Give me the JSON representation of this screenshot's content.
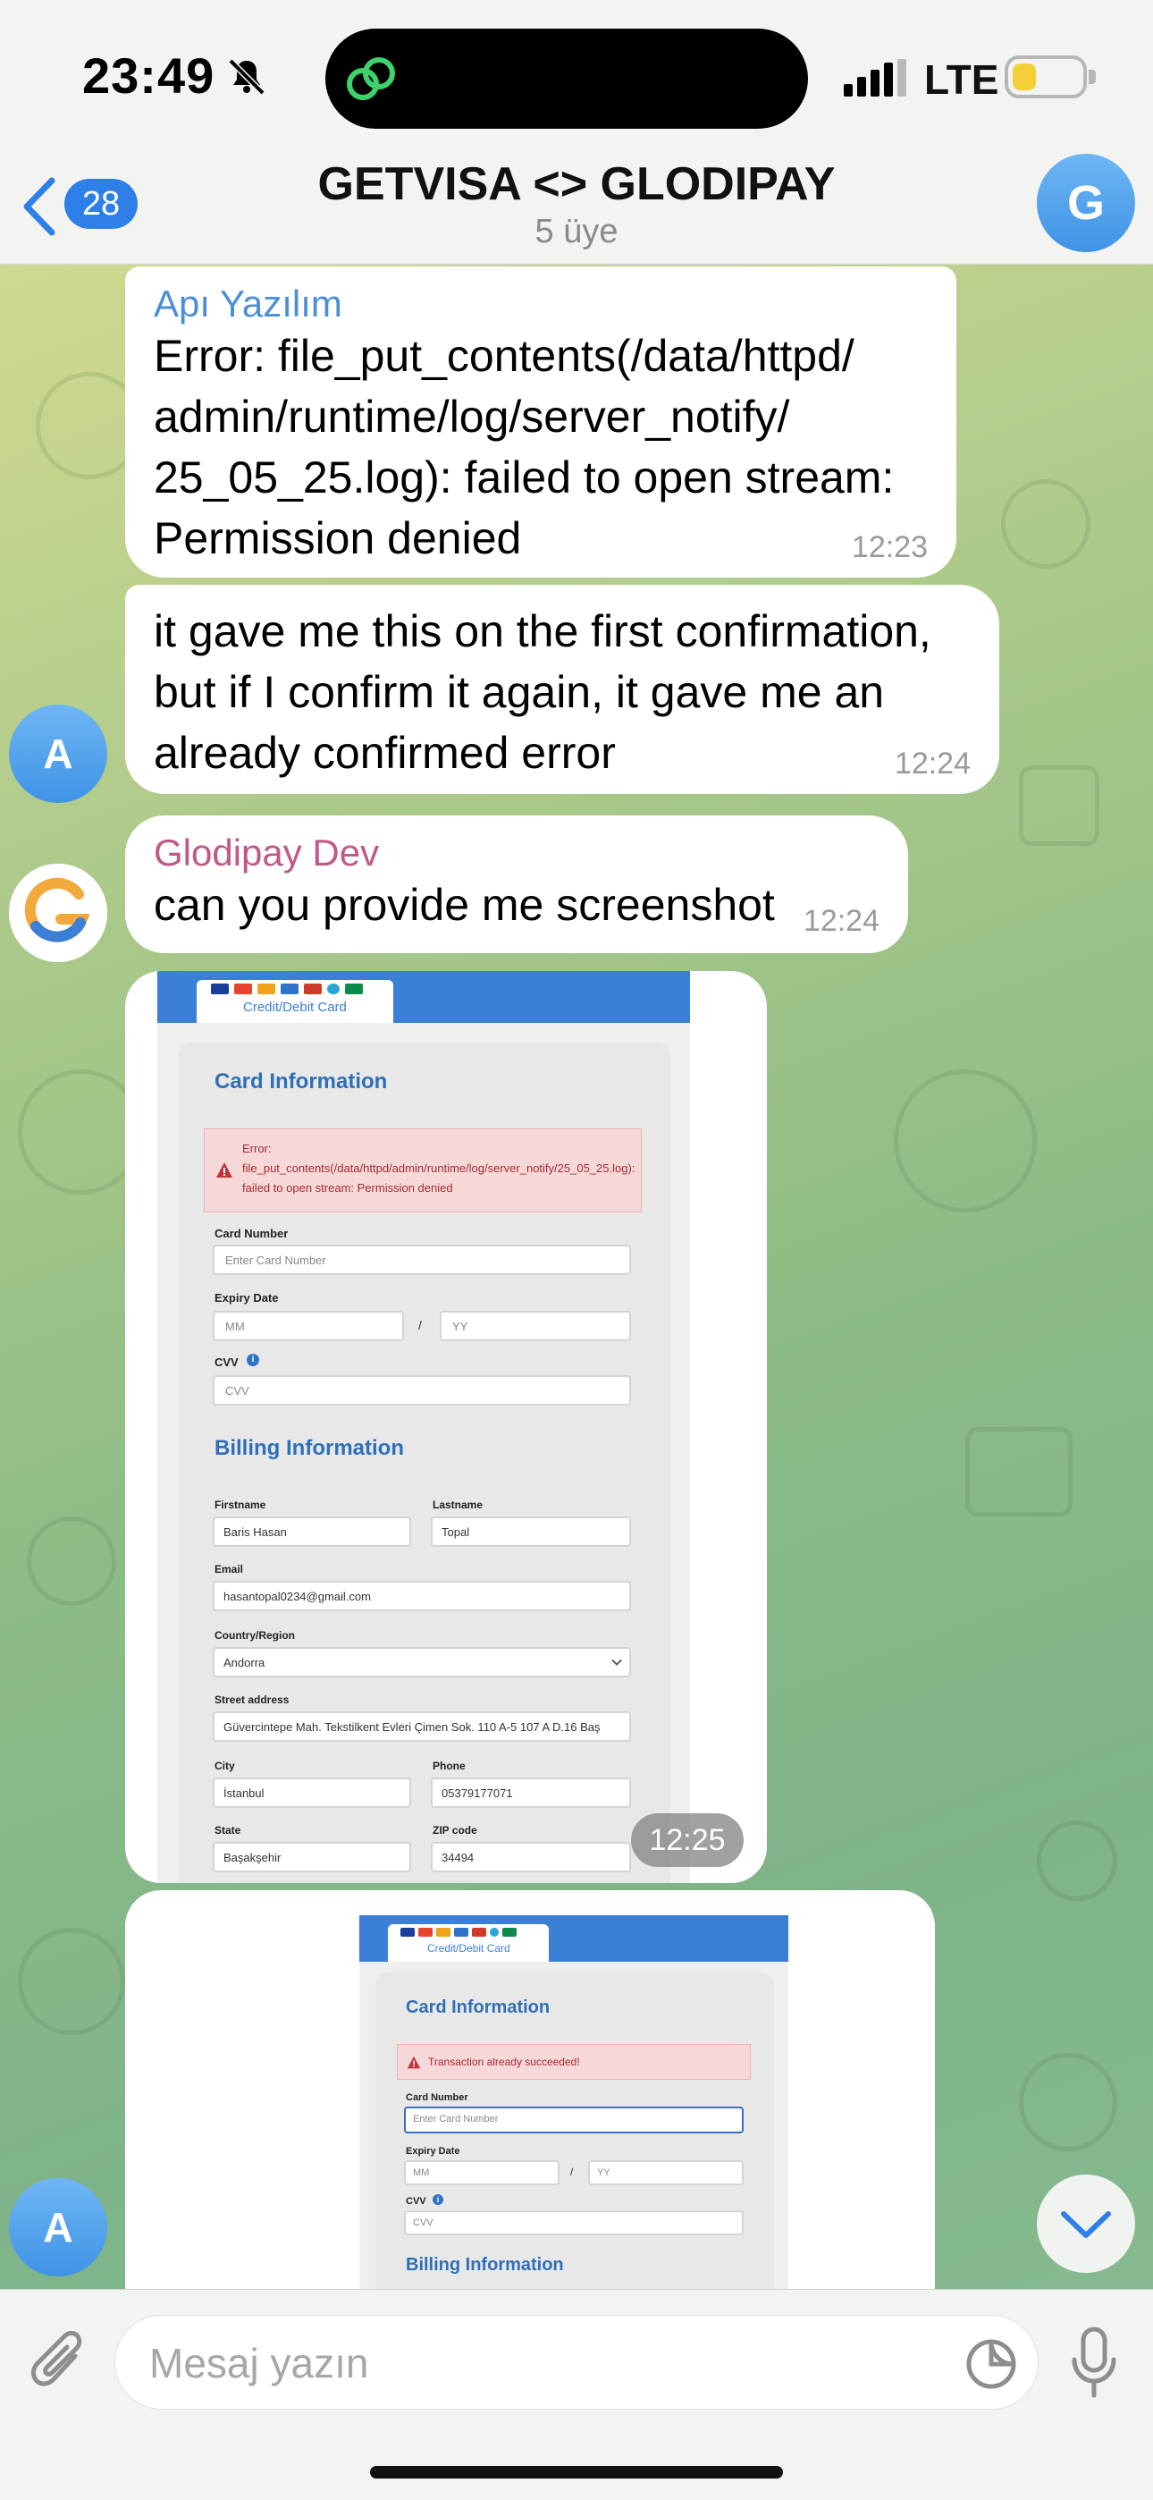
{
  "status_bar": {
    "time": "23:49",
    "network": "LTE"
  },
  "header": {
    "back_count": "28",
    "title": "GETVISA <> GLODIPAY",
    "subtitle": "5 üye",
    "avatar_letter": "G"
  },
  "messages": [
    {
      "sender": "Apı Yazılım",
      "sender_color": "#4a8fd8",
      "text": "Error: file_put_contents(/data/httpd/\nadmin/runtime/log/server_notify/\n25_05_25.log): failed to open stream:\nPermission denied",
      "time": "12:23"
    },
    {
      "text": "it gave me this on the first confirmation,\nbut if I confirm it again, it gave me an\nalready confirmed error",
      "time": "12:24",
      "avatar_letter": "A"
    },
    {
      "sender": "Glodipay Dev",
      "sender_color": "#c0588a",
      "text": "can you provide me screenshot",
      "time": "12:24"
    }
  ],
  "screenshot1": {
    "tab_label": "Credit/Debit Card",
    "card_heading": "Card Information",
    "error_line1": "Error:",
    "error_line2": "file_put_contents(/data/httpd/admin/runtime/log/server_notify/25_05_25.log):",
    "error_line3": "failed to open stream: Permission denied",
    "card_number_label": "Card Number",
    "card_number_placeholder": "Enter Card Number",
    "expiry_label": "Expiry Date",
    "mm": "MM",
    "slash": "/",
    "yy": "YY",
    "cvv_label": "CVV",
    "cvv_placeholder": "CVV",
    "billing_heading": "Billing Information",
    "firstname_label": "Firstname",
    "firstname": "Baris Hasan",
    "lastname_label": "Lastname",
    "lastname": "Topal",
    "email_label": "Email",
    "email": "hasantopal0234@gmail.com",
    "country_label": "Country/Region",
    "country": "Andorra",
    "street_label": "Street address",
    "street": "Güvercintepe Mah. Tekstilkent Evleri Çimen Sok. 110 A-5 107 A D.16 Baş",
    "city_label": "City",
    "city": "İstanbul",
    "phone_label": "Phone",
    "phone": "05379177071",
    "state_label": "State",
    "state": "Başakşehir",
    "zip_label": "ZIP code",
    "zip": "34494",
    "time": "12:25"
  },
  "screenshot2": {
    "tab_label": "Credit/Debit Card",
    "card_heading": "Card Information",
    "error": "Transaction already succeeded!",
    "card_number_label": "Card Number",
    "card_number_placeholder": "Enter Card Number",
    "expiry_label": "Expiry Date",
    "mm": "MM",
    "slash": "/",
    "yy": "YY",
    "cvv_label": "CVV",
    "cvv_placeholder": "CVV",
    "billing_heading": "Billing Information"
  },
  "bottom_avatar_letter": "A",
  "composer": {
    "placeholder": "Mesaj yazın"
  }
}
